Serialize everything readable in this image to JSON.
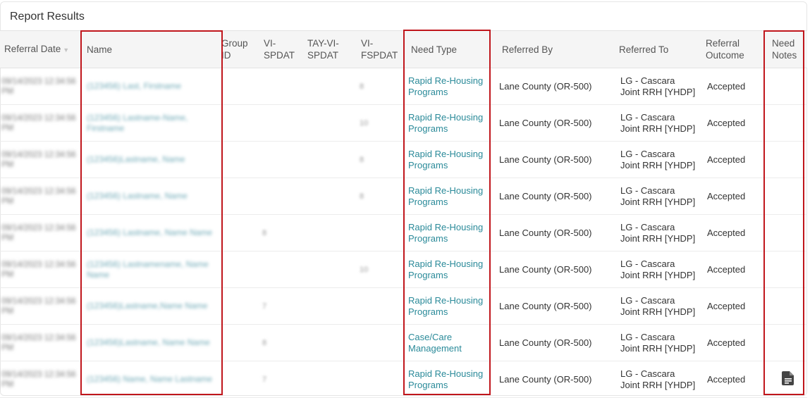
{
  "panel": {
    "title": "Report Results"
  },
  "columns": {
    "referral_date": "Referral Date",
    "name": "Name",
    "group_id": "Group ID",
    "vi_spdat": "VI-SPDAT",
    "tay_vi_spdat": "TAY-VI-SPDAT",
    "vi_fspdat": "VI-FSPDAT",
    "need_type": "Need Type",
    "referred_by": "Referred By",
    "referred_to": "Referred To",
    "referral_outcome": "Referral Outcome",
    "need_notes": "Need Notes"
  },
  "sort": {
    "column": "referral_date",
    "icon": "sort-down-icon"
  },
  "rows": [
    {
      "date": "09/14/2023 12:34:56 PM",
      "name": "(123456) Last, Firstname",
      "group_id": "",
      "vi_spdat": "",
      "tay": "",
      "vi_fspdat": "8",
      "need_type": "Rapid Re-Housing Programs",
      "referred_by": "Lane County (OR-500)",
      "referred_to": "LG - Cascara Joint RRH [YHDP]",
      "outcome": "Accepted",
      "has_note": false
    },
    {
      "date": "09/14/2023 12:34:56 PM",
      "name": "(123456) Lastname-Name, Firstname",
      "group_id": "",
      "vi_spdat": "",
      "tay": "",
      "vi_fspdat": "10",
      "need_type": "Rapid Re-Housing Programs",
      "referred_by": "Lane County (OR-500)",
      "referred_to": "LG - Cascara Joint RRH [YHDP]",
      "outcome": "Accepted",
      "has_note": false
    },
    {
      "date": "09/14/2023 12:34:56 PM",
      "name": "(123456)Lastname, Name",
      "group_id": "",
      "vi_spdat": "",
      "tay": "",
      "vi_fspdat": "8",
      "need_type": "Rapid Re-Housing Programs",
      "referred_by": "Lane County (OR-500)",
      "referred_to": "LG - Cascara Joint RRH [YHDP]",
      "outcome": "Accepted",
      "has_note": false
    },
    {
      "date": "09/14/2023 12:34:56 PM",
      "name": "(123456) Lastname, Name",
      "group_id": "",
      "vi_spdat": "",
      "tay": "",
      "vi_fspdat": "8",
      "need_type": "Rapid Re-Housing Programs",
      "referred_by": "Lane County (OR-500)",
      "referred_to": "LG - Cascara Joint RRH [YHDP]",
      "outcome": "Accepted",
      "has_note": false
    },
    {
      "date": "09/14/2023 12:34:56 PM",
      "name": "(123456) Lastname, Name Name",
      "group_id": "",
      "vi_spdat": "8",
      "tay": "",
      "vi_fspdat": "",
      "need_type": "Rapid Re-Housing Programs",
      "referred_by": "Lane County (OR-500)",
      "referred_to": "LG - Cascara Joint RRH [YHDP]",
      "outcome": "Accepted",
      "has_note": false
    },
    {
      "date": "09/14/2023 12:34:56 PM",
      "name": "(123456) Lastnamename, Name Name",
      "group_id": "",
      "vi_spdat": "",
      "tay": "",
      "vi_fspdat": "10",
      "need_type": "Rapid Re-Housing Programs",
      "referred_by": "Lane County (OR-500)",
      "referred_to": "LG - Cascara Joint RRH [YHDP]",
      "outcome": "Accepted",
      "has_note": false
    },
    {
      "date": "09/14/2023 12:34:56 PM",
      "name": "(123456)Lastname,Name Name",
      "group_id": "",
      "vi_spdat": "7",
      "tay": "",
      "vi_fspdat": "",
      "need_type": "Rapid Re-Housing Programs",
      "referred_by": "Lane County (OR-500)",
      "referred_to": "LG - Cascara Joint RRH [YHDP]",
      "outcome": "Accepted",
      "has_note": false
    },
    {
      "date": "09/14/2023 12:34:56 PM",
      "name": "(123456)Lastname, Name Name",
      "group_id": "",
      "vi_spdat": "8",
      "tay": "",
      "vi_fspdat": "",
      "need_type": "Case/Care Management",
      "referred_by": "Lane County (OR-500)",
      "referred_to": "LG - Cascara Joint RRH [YHDP]",
      "outcome": "Accepted",
      "has_note": false
    },
    {
      "date": "09/14/2023 12:34:56 PM",
      "name": "(123456) Name, Name Lastname",
      "group_id": "",
      "vi_spdat": "7",
      "tay": "",
      "vi_fspdat": "",
      "need_type": "Rapid Re-Housing Programs",
      "referred_by": "Lane County (OR-500)",
      "referred_to": "LG - Cascara Joint RRH [YHDP]",
      "outcome": "Accepted",
      "has_note": true,
      "note_icon": "document-icon"
    }
  ],
  "highlight_color": "#c0161c",
  "link_color": "#2a8a99"
}
